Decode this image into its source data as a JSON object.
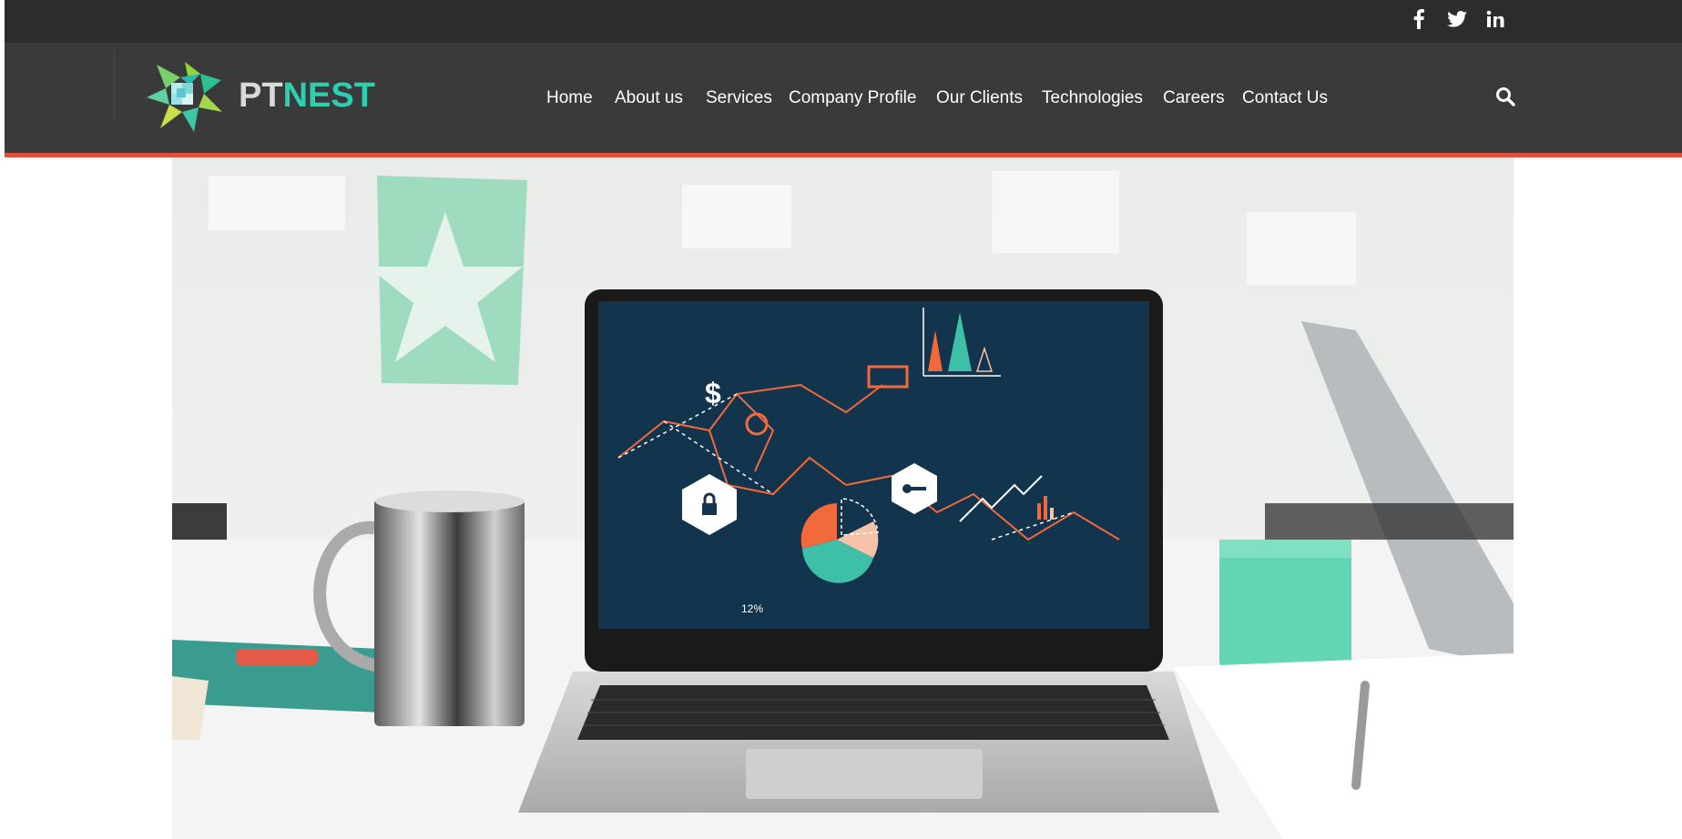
{
  "brand": {
    "prefix": "PT",
    "suffix": "NEST"
  },
  "social": [
    {
      "name": "facebook-icon",
      "glyph": "f"
    },
    {
      "name": "twitter-icon",
      "glyph": "t"
    },
    {
      "name": "linkedin-icon",
      "glyph": "in"
    }
  ],
  "nav": {
    "items": [
      {
        "label": "Home"
      },
      {
        "label": "About us"
      },
      {
        "label": "Services"
      },
      {
        "label": "Company Profile"
      },
      {
        "label": "Our Clients"
      },
      {
        "label": "Technologies"
      },
      {
        "label": "Careers"
      },
      {
        "label": "Contact Us"
      }
    ]
  },
  "hero": {
    "screen_label": "12%",
    "colors": {
      "screen": "#12344d",
      "accent": "#f26a3b",
      "teal": "#3dbfa8",
      "peach": "#f7c3a8"
    }
  },
  "colors": {
    "topbar": "#2c2c2c",
    "header": "#3a3a3a",
    "accent_line": "#e0513a",
    "brand_teal": "#2ccfb0"
  }
}
